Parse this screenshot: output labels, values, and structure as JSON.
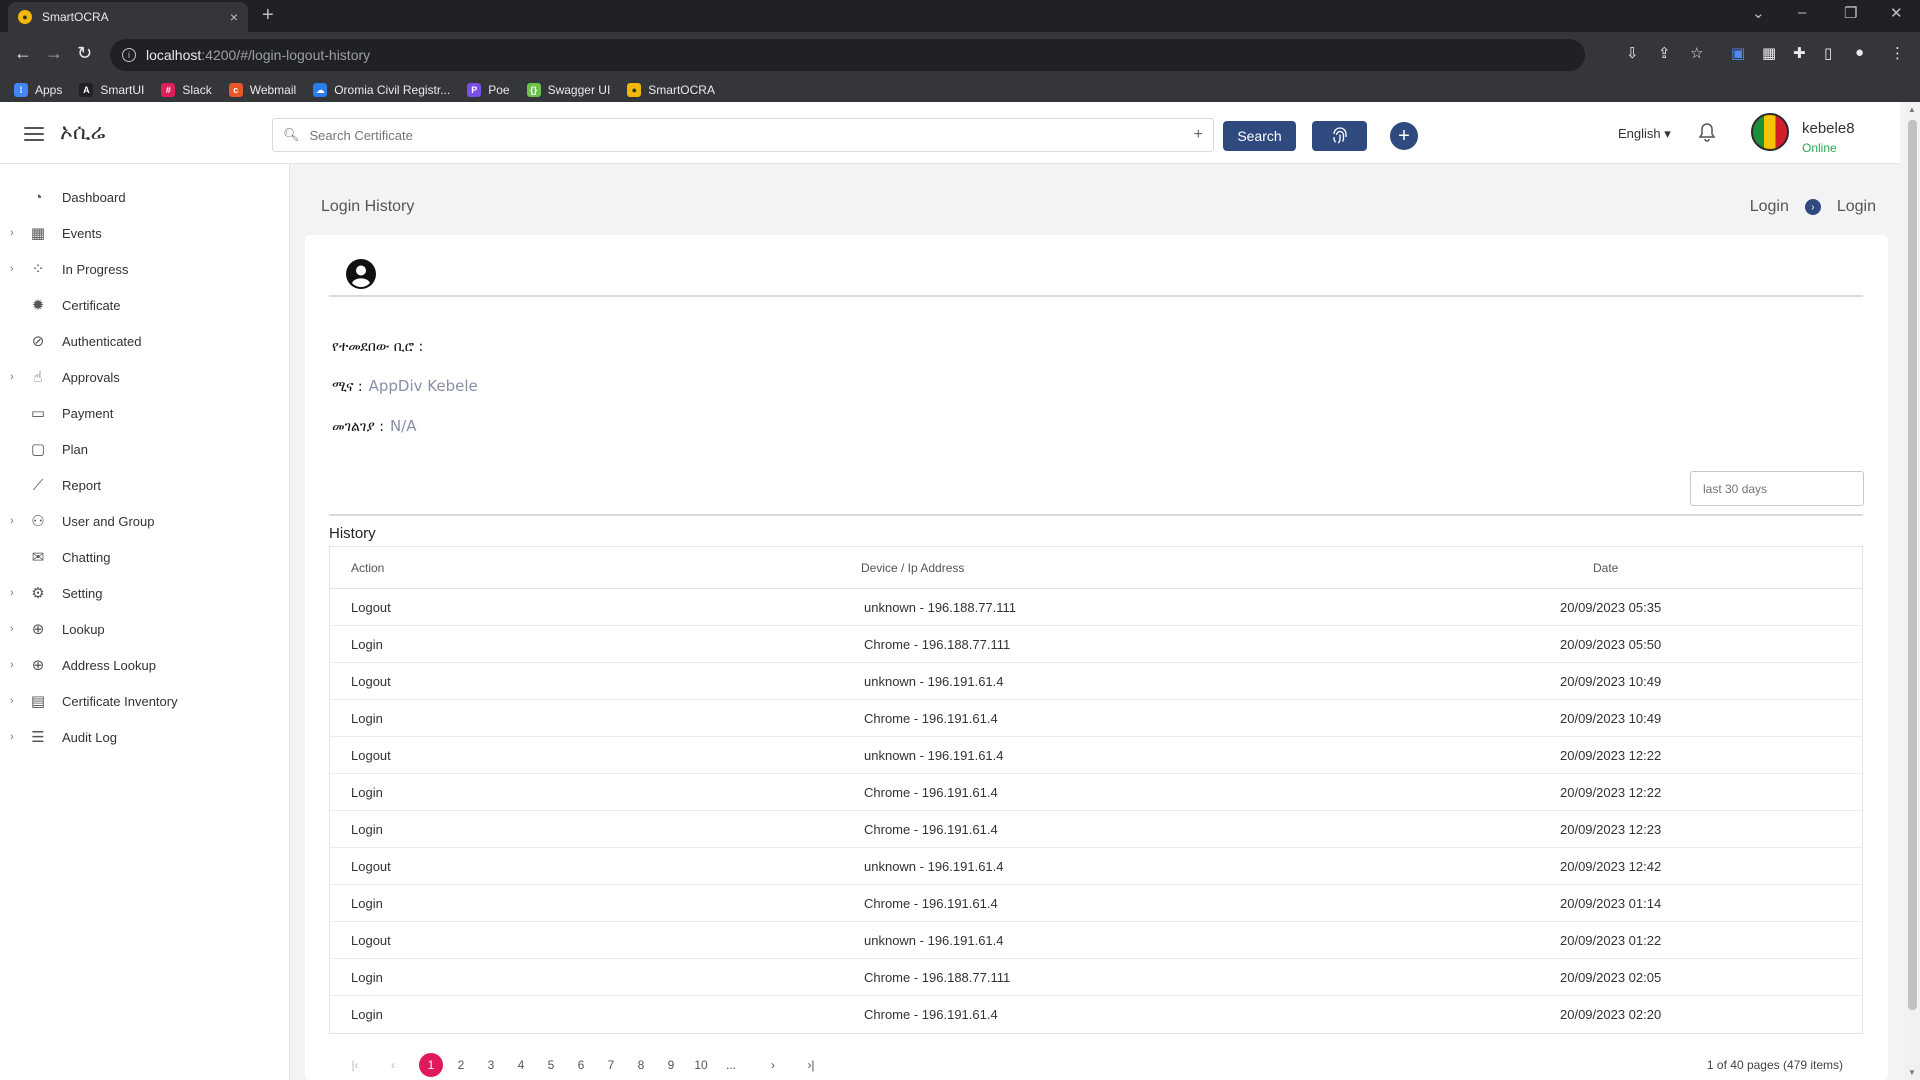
{
  "browser": {
    "tab_title": "SmartOCRA",
    "tab_close": "×",
    "new_tab": "+",
    "url_host": "localhost",
    "url_path": ":4200/#/login-logout-history",
    "bookmarks": [
      "Apps",
      "SmartUI",
      "Slack",
      "Webmail",
      "Oromia Civil Registr...",
      "Poe",
      "Swagger UI",
      "SmartOCRA"
    ]
  },
  "header": {
    "brand": "ኦሲሬ",
    "search_placeholder": "Search Certificate",
    "search_button": "Search",
    "language": "English",
    "user_name": "kebele8",
    "user_status": "Online"
  },
  "sidebar": {
    "items": [
      {
        "label": "Dashboard",
        "icon": "dashboard-icon",
        "expandable": false
      },
      {
        "label": "Events",
        "icon": "calendar-icon",
        "expandable": true
      },
      {
        "label": "In Progress",
        "icon": "spinner-icon",
        "expandable": true
      },
      {
        "label": "Certificate",
        "icon": "certificate-icon",
        "expandable": false
      },
      {
        "label": "Authenticated",
        "icon": "check-circle-icon",
        "expandable": false
      },
      {
        "label": "Approvals",
        "icon": "thumbs-up-icon",
        "expandable": true
      },
      {
        "label": "Payment",
        "icon": "credit-card-icon",
        "expandable": false
      },
      {
        "label": "Plan",
        "icon": "calendar-plan-icon",
        "expandable": false
      },
      {
        "label": "Report",
        "icon": "chart-line-icon",
        "expandable": false
      },
      {
        "label": "User and Group",
        "icon": "users-icon",
        "expandable": true
      },
      {
        "label": "Chatting",
        "icon": "chat-icon",
        "expandable": false
      },
      {
        "label": "Setting",
        "icon": "gear-icon",
        "expandable": true
      },
      {
        "label": "Lookup",
        "icon": "search-plus-icon",
        "expandable": true
      },
      {
        "label": "Address Lookup",
        "icon": "search-plus-icon",
        "expandable": true
      },
      {
        "label": "Certificate Inventory",
        "icon": "archive-icon",
        "expandable": true
      },
      {
        "label": "Audit Log",
        "icon": "list-icon",
        "expandable": true
      }
    ]
  },
  "page": {
    "title": "Login History",
    "breadcrumb": [
      "Login",
      "Login"
    ]
  },
  "profile": {
    "office_label": "የተመደበው ቢሮ :",
    "office_value": "",
    "role_label": "ሚና :",
    "role_value": "AppDiv Kebele",
    "address_label": "መገልገያ :",
    "address_value": "N/A"
  },
  "filter": {
    "range_placeholder": "last 30 days"
  },
  "history": {
    "title": "History",
    "columns": [
      "Action",
      "Device / Ip Address",
      "Date"
    ],
    "rows": [
      {
        "action": "Logout",
        "device": "unknown - 196.188.77.111",
        "date": "20/09/2023 05:35"
      },
      {
        "action": "Login",
        "device": "Chrome - 196.188.77.111",
        "date": "20/09/2023 05:50"
      },
      {
        "action": "Logout",
        "device": "unknown - 196.191.61.4",
        "date": "20/09/2023 10:49"
      },
      {
        "action": "Login",
        "device": "Chrome - 196.191.61.4",
        "date": "20/09/2023 10:49"
      },
      {
        "action": "Logout",
        "device": "unknown - 196.191.61.4",
        "date": "20/09/2023 12:22"
      },
      {
        "action": "Login",
        "device": "Chrome - 196.191.61.4",
        "date": "20/09/2023 12:22"
      },
      {
        "action": "Login",
        "device": "Chrome - 196.191.61.4",
        "date": "20/09/2023 12:23"
      },
      {
        "action": "Logout",
        "device": "unknown - 196.191.61.4",
        "date": "20/09/2023 12:42"
      },
      {
        "action": "Login",
        "device": "Chrome - 196.191.61.4",
        "date": "20/09/2023 01:14"
      },
      {
        "action": "Logout",
        "device": "unknown - 196.191.61.4",
        "date": "20/09/2023 01:22"
      },
      {
        "action": "Login",
        "device": "Chrome - 196.188.77.111",
        "date": "20/09/2023 02:05"
      },
      {
        "action": "Login",
        "device": "Chrome - 196.191.61.4",
        "date": "20/09/2023 02:20"
      }
    ]
  },
  "pagination": {
    "pages": [
      "1",
      "2",
      "3",
      "4",
      "5",
      "6",
      "7",
      "8",
      "9",
      "10",
      "..."
    ],
    "current": "1",
    "info": "1 of 40 pages (479 items)"
  },
  "colors": {
    "primary": "#2f4a7e",
    "active_page": "#e0195c",
    "online": "#2aa84a"
  }
}
